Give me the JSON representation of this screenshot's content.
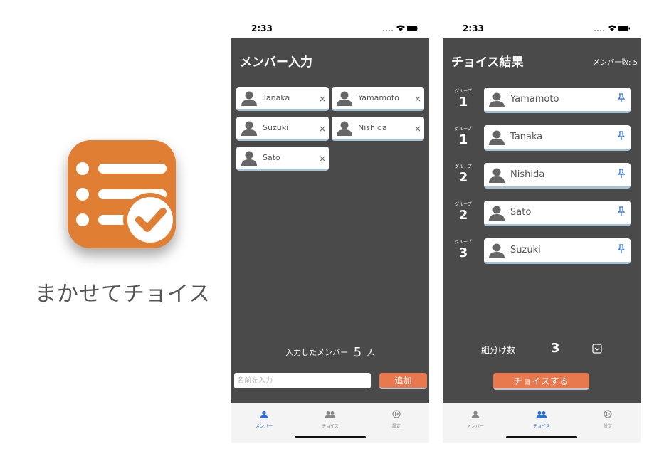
{
  "app": {
    "name": "まかせてチョイス",
    "colors": {
      "brand": "#e07f34",
      "accent": "#e8794f",
      "tab_active": "#2d6fd6",
      "background_dark": "#4a4a4a"
    }
  },
  "phone1": {
    "status_time": "2:33",
    "title": "メンバー入力",
    "members": [
      {
        "name": "Tanaka",
        "remove": "×"
      },
      {
        "name": "Yamamoto",
        "remove": "×"
      },
      {
        "name": "Suzuki",
        "remove": "×"
      },
      {
        "name": "Nishida",
        "remove": "×"
      },
      {
        "name": "Sato",
        "remove": "×"
      }
    ],
    "entered_label": "入力したメンバー",
    "entered_count": "5",
    "entered_unit": "人",
    "input_placeholder": "名前を入力",
    "add_button": "追加"
  },
  "phone2": {
    "status_time": "2:33",
    "title": "チョイス結果",
    "member_count": "メンバー数: 5",
    "group_label": "グループ",
    "results": [
      {
        "group": "1",
        "name": "Yamamoto"
      },
      {
        "group": "1",
        "name": "Tanaka"
      },
      {
        "group": "2",
        "name": "Nishida"
      },
      {
        "group": "2",
        "name": "Sato"
      },
      {
        "group": "3",
        "name": "Suzuki"
      }
    ],
    "groups_label": "組分け数",
    "groups_value": "3",
    "choice_button": "チョイスする"
  },
  "tabs": [
    {
      "label": "メンバー",
      "icon": "person-icon"
    },
    {
      "label": "チョイス",
      "icon": "people-icon"
    },
    {
      "label": "設定",
      "icon": "settings-icon"
    }
  ]
}
